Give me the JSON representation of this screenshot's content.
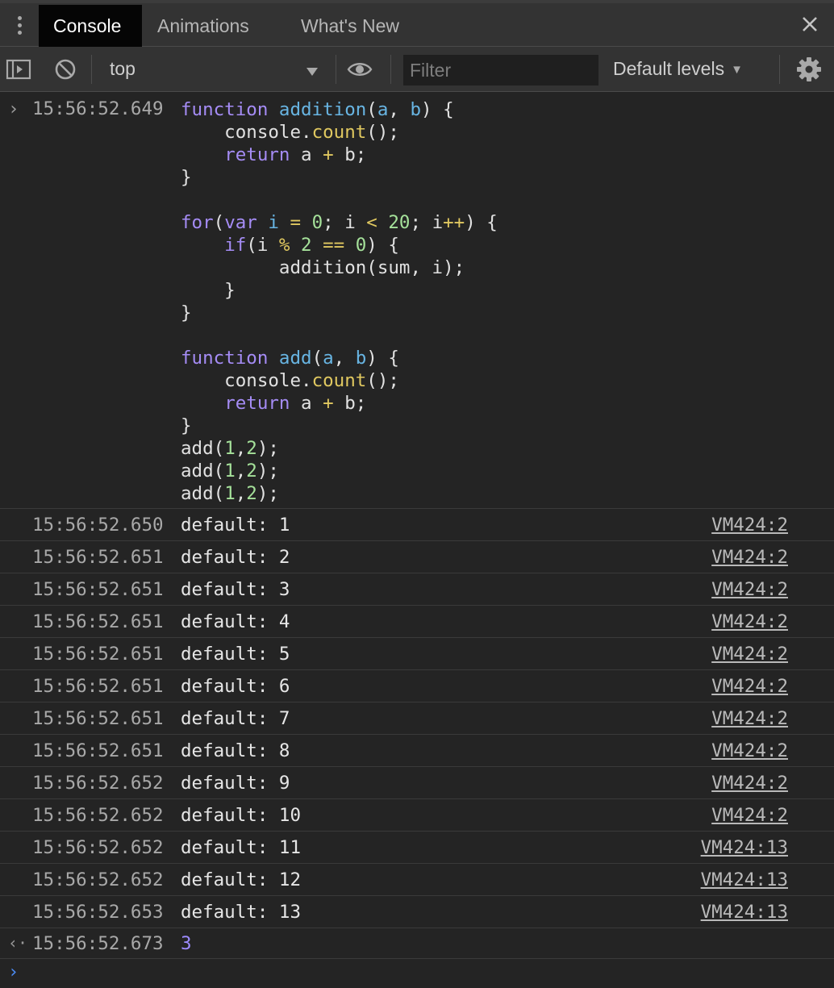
{
  "tabs": [
    {
      "label": "Console",
      "active": true
    },
    {
      "label": "Animations",
      "active": false
    },
    {
      "label": "What's New",
      "active": false
    }
  ],
  "toolbar": {
    "context": "top",
    "filter_placeholder": "Filter",
    "levels_label": "Default levels",
    "levels_caret": "▼"
  },
  "input_entry": {
    "gutter": "›",
    "timestamp": "15:56:52.649"
  },
  "code_lines": [
    [
      [
        "function",
        "kw"
      ],
      [
        " ",
        ""
      ],
      [
        "addition",
        "fn"
      ],
      [
        "(",
        ""
      ],
      [
        "a",
        "pm"
      ],
      [
        ", ",
        ""
      ],
      [
        "b",
        "pm"
      ],
      [
        ") {",
        ""
      ]
    ],
    [
      [
        "    console.",
        ""
      ],
      [
        "count",
        "mt"
      ],
      [
        "();",
        ""
      ]
    ],
    [
      [
        "    ",
        ""
      ],
      [
        "return",
        "kw"
      ],
      [
        " a ",
        ""
      ],
      [
        "+",
        "op"
      ],
      [
        " b;",
        ""
      ]
    ],
    [
      [
        "}",
        ""
      ]
    ],
    [
      [
        "",
        ""
      ]
    ],
    [
      [
        "for",
        "kw"
      ],
      [
        "(",
        ""
      ],
      [
        "var",
        "kw"
      ],
      [
        " ",
        ""
      ],
      [
        "i",
        "pm"
      ],
      [
        " ",
        ""
      ],
      [
        "=",
        "op"
      ],
      [
        " ",
        ""
      ],
      [
        "0",
        "nm"
      ],
      [
        "; i ",
        ""
      ],
      [
        "<",
        "op"
      ],
      [
        " ",
        ""
      ],
      [
        "20",
        "nm"
      ],
      [
        "; i",
        ""
      ],
      [
        "++",
        "op"
      ],
      [
        ") {",
        ""
      ]
    ],
    [
      [
        "    ",
        ""
      ],
      [
        "if",
        "kw"
      ],
      [
        "(i ",
        ""
      ],
      [
        "%",
        "op"
      ],
      [
        " ",
        ""
      ],
      [
        "2",
        "nm"
      ],
      [
        " ",
        ""
      ],
      [
        "==",
        "op"
      ],
      [
        " ",
        ""
      ],
      [
        "0",
        "nm"
      ],
      [
        ") {",
        ""
      ]
    ],
    [
      [
        "         addition(sum, i);",
        ""
      ]
    ],
    [
      [
        "    }",
        ""
      ]
    ],
    [
      [
        "}",
        ""
      ]
    ],
    [
      [
        "",
        ""
      ]
    ],
    [
      [
        "function",
        "kw"
      ],
      [
        " ",
        ""
      ],
      [
        "add",
        "fn"
      ],
      [
        "(",
        ""
      ],
      [
        "a",
        "pm"
      ],
      [
        ", ",
        ""
      ],
      [
        "b",
        "pm"
      ],
      [
        ") {",
        ""
      ]
    ],
    [
      [
        "    console.",
        ""
      ],
      [
        "count",
        "mt"
      ],
      [
        "();",
        ""
      ]
    ],
    [
      [
        "    ",
        ""
      ],
      [
        "return",
        "kw"
      ],
      [
        " a ",
        ""
      ],
      [
        "+",
        "op"
      ],
      [
        " b;",
        ""
      ]
    ],
    [
      [
        "}",
        ""
      ]
    ],
    [
      [
        "add(",
        ""
      ],
      [
        "1",
        "nm"
      ],
      [
        ",",
        ""
      ],
      [
        "2",
        "nm"
      ],
      [
        ");",
        ""
      ]
    ],
    [
      [
        "add(",
        ""
      ],
      [
        "1",
        "nm"
      ],
      [
        ",",
        ""
      ],
      [
        "2",
        "nm"
      ],
      [
        ");",
        ""
      ]
    ],
    [
      [
        "add(",
        ""
      ],
      [
        "1",
        "nm"
      ],
      [
        ",",
        ""
      ],
      [
        "2",
        "nm"
      ],
      [
        ");",
        ""
      ]
    ]
  ],
  "logs": [
    {
      "timestamp": "15:56:52.650",
      "text": "default: 1",
      "source": "VM424:2"
    },
    {
      "timestamp": "15:56:52.651",
      "text": "default: 2",
      "source": "VM424:2"
    },
    {
      "timestamp": "15:56:52.651",
      "text": "default: 3",
      "source": "VM424:2"
    },
    {
      "timestamp": "15:56:52.651",
      "text": "default: 4",
      "source": "VM424:2"
    },
    {
      "timestamp": "15:56:52.651",
      "text": "default: 5",
      "source": "VM424:2"
    },
    {
      "timestamp": "15:56:52.651",
      "text": "default: 6",
      "source": "VM424:2"
    },
    {
      "timestamp": "15:56:52.651",
      "text": "default: 7",
      "source": "VM424:2"
    },
    {
      "timestamp": "15:56:52.651",
      "text": "default: 8",
      "source": "VM424:2"
    },
    {
      "timestamp": "15:56:52.652",
      "text": "default: 9",
      "source": "VM424:2"
    },
    {
      "timestamp": "15:56:52.652",
      "text": "default: 10",
      "source": "VM424:2"
    },
    {
      "timestamp": "15:56:52.652",
      "text": "default: 11",
      "source": "VM424:13"
    },
    {
      "timestamp": "15:56:52.652",
      "text": "default: 12",
      "source": "VM424:13"
    },
    {
      "timestamp": "15:56:52.653",
      "text": "default: 13",
      "source": "VM424:13"
    }
  ],
  "result": {
    "gutter": "‹·",
    "timestamp": "15:56:52.673",
    "value": "3"
  },
  "prompt": {
    "caret": "›"
  },
  "icons": {
    "menu": "kebab-menu-icon",
    "close": "close-icon",
    "sidebar": "sidebar-toggle-icon",
    "clear": "clear-console-icon",
    "eye": "eye-icon",
    "settings": "gear-icon"
  },
  "colors": {
    "background": "#242424",
    "toolbar": "#333333",
    "active_tab": "#050505",
    "keyword": "#a58cf5",
    "function_name": "#68b5e3",
    "number": "#a5e19a",
    "operator": "#e0c860",
    "result_value": "#9d8cff",
    "prompt": "#4c8df6"
  }
}
